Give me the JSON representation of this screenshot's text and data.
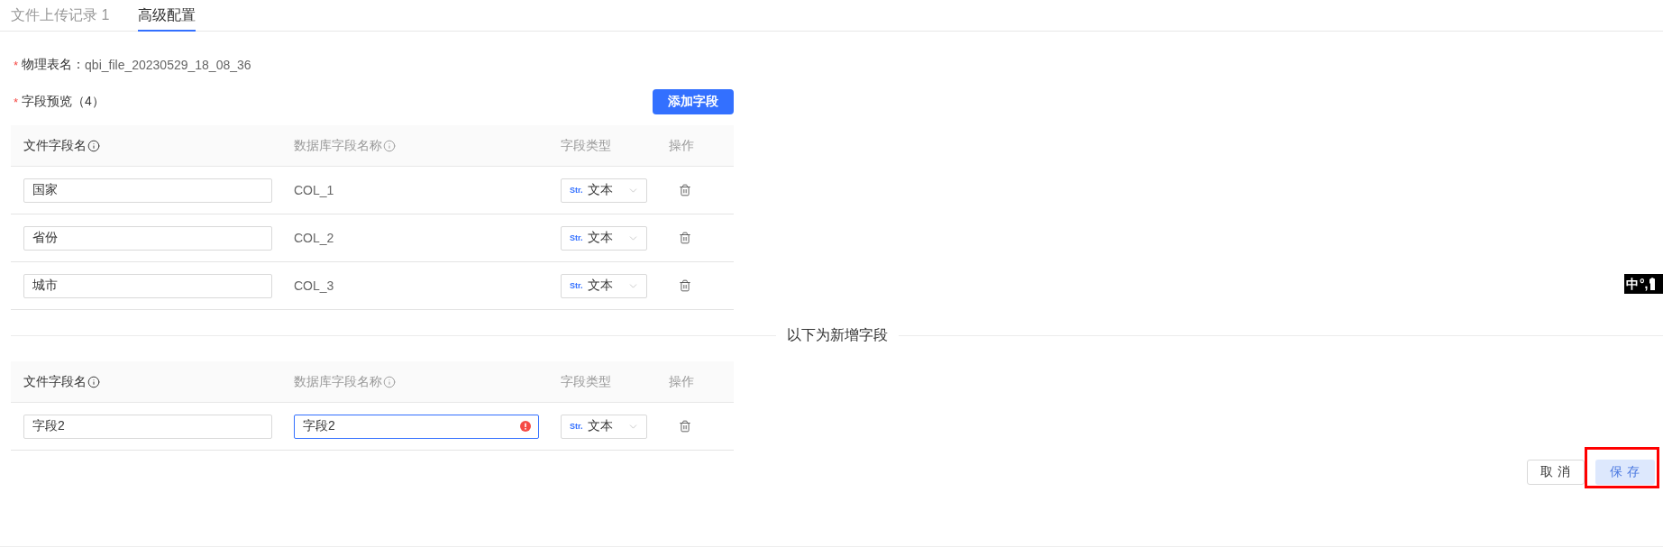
{
  "tabs": [
    {
      "label": "文件上传记录 1",
      "selected": false
    },
    {
      "label": "高级配置",
      "selected": true
    }
  ],
  "table_name": {
    "required_mark": "*",
    "label": "物理表名：",
    "value": "qbi_file_20230529_18_08_36"
  },
  "field_preview": {
    "required_mark": "*",
    "label": "字段预览（4）",
    "add_button": "添加字段"
  },
  "existing_fields": {
    "columns": [
      {
        "label": "文件字段名",
        "info": true,
        "muted": false
      },
      {
        "label": "数据库字段名称",
        "info": true,
        "muted": true
      },
      {
        "label": "字段类型",
        "info": false,
        "muted": true
      },
      {
        "label": "操作",
        "info": false,
        "muted": true
      }
    ],
    "rows": [
      {
        "file_field": "国家",
        "db_field": {
          "kind": "text",
          "value": "COL_1"
        },
        "type_tag": "Str.",
        "type": "文本"
      },
      {
        "file_field": "省份",
        "db_field": {
          "kind": "text",
          "value": "COL_2"
        },
        "type_tag": "Str.",
        "type": "文本"
      },
      {
        "file_field": "城市",
        "db_field": {
          "kind": "text",
          "value": "COL_3"
        },
        "type_tag": "Str.",
        "type": "文本"
      }
    ]
  },
  "new_fields_divider": "以下为新增字段",
  "new_fields": {
    "columns": [
      {
        "label": "文件字段名",
        "info": true,
        "muted": false
      },
      {
        "label": "数据库字段名称",
        "info": true,
        "muted": true
      },
      {
        "label": "字段类型",
        "info": false,
        "muted": true
      },
      {
        "label": "操作",
        "info": false,
        "muted": true
      }
    ],
    "rows": [
      {
        "file_field": "字段2",
        "db_field": {
          "kind": "input",
          "value": "字段2",
          "focused": true,
          "error": true
        },
        "type_tag": "Str.",
        "type": "文本"
      }
    ]
  },
  "buttons": [
    {
      "label": "取 消",
      "kind": "default",
      "disabled": false,
      "highlighted": false
    },
    {
      "label": "保 存",
      "kind": "primary",
      "disabled": true,
      "highlighted": true
    }
  ],
  "ime_indicator": {
    "mode": "中",
    "punctuation": "°,"
  }
}
